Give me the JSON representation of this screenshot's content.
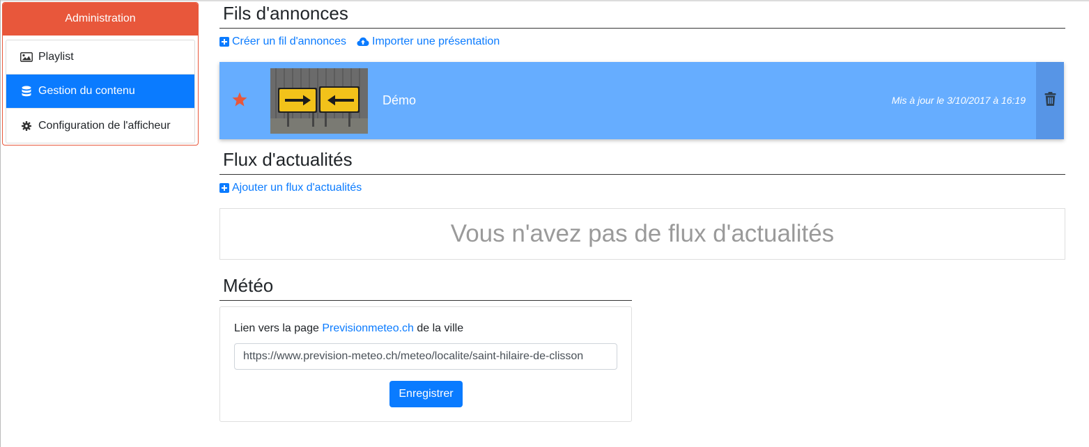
{
  "sidebar": {
    "header": "Administration",
    "items": [
      {
        "label": "Playlist",
        "icon": "image-icon"
      },
      {
        "label": "Gestion du contenu",
        "icon": "database-icon",
        "active": true
      },
      {
        "label": "Configuration de l'afficheur",
        "icon": "gear-icon"
      }
    ]
  },
  "announcements": {
    "title": "Fils d'annonces",
    "create_label": "Créer un fil d'annonces",
    "import_label": "Importer une présentation",
    "items": [
      {
        "name": "Démo",
        "updated": "Mis à jour le 3/10/2017 à 16:19",
        "favorite": true
      }
    ]
  },
  "news": {
    "title": "Flux d'actualités",
    "add_label": "Ajouter un flux d'actualités",
    "empty_message": "Vous n'avez pas de flux d'actualités"
  },
  "meteo": {
    "title": "Météo",
    "label_prefix": "Lien vers la page ",
    "label_link": "Previsionmeteo.ch",
    "label_suffix": " de la ville",
    "url_value": "https://www.prevision-meteo.ch/meteo/localite/saint-hilaire-de-clisson",
    "save_label": "Enregistrer"
  },
  "colors": {
    "accent": "#e8573b",
    "primary": "#0a7bff",
    "card_bg": "#66adff",
    "delete_bg": "#5795e6"
  }
}
